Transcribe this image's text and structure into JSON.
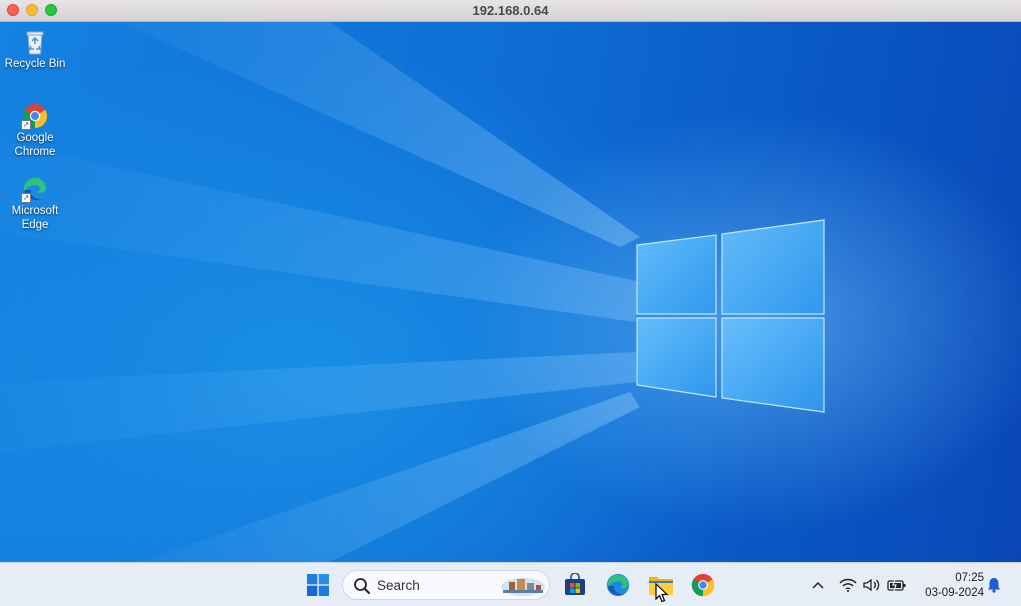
{
  "window": {
    "title": "192.168.0.64"
  },
  "desktop": {
    "icons": [
      {
        "label_line1": "Recycle Bin",
        "label_line2": "",
        "icon": "recycle-bin-icon"
      },
      {
        "label_line1": "Google",
        "label_line2": "Chrome",
        "icon": "chrome-icon"
      },
      {
        "label_line1": "Microsoft",
        "label_line2": "Edge",
        "icon": "edge-icon"
      }
    ]
  },
  "taskbar": {
    "start_icon": "windows-start-icon",
    "search": {
      "placeholder": "Search",
      "icon": "search-icon"
    },
    "pinned": [
      {
        "name": "Microsoft Store",
        "icon": "store-icon"
      },
      {
        "name": "Microsoft Edge",
        "icon": "edge-icon"
      },
      {
        "name": "File Explorer",
        "icon": "folder-icon"
      },
      {
        "name": "Google Chrome",
        "icon": "chrome-icon"
      }
    ],
    "tray": {
      "icons": [
        "chevron-up-icon",
        "wifi-icon",
        "volume-icon",
        "battery-icon"
      ],
      "time": "07:25",
      "date": "03-09-2024",
      "notification_icon": "bell-icon"
    }
  },
  "colors": {
    "desktop_blue": "#0f6fd6",
    "taskbar_bg": "#e6edf6",
    "title_bar": "#dedbdd"
  }
}
